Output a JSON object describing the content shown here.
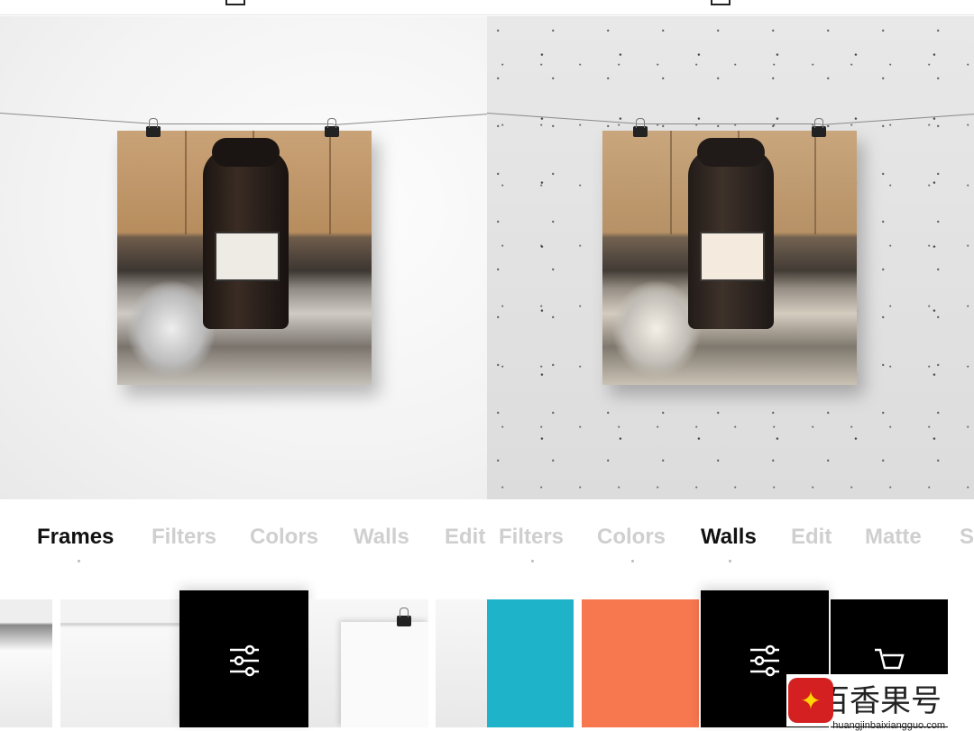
{
  "tabs_left": [
    {
      "label": "Frames",
      "active": true
    },
    {
      "label": "Filters",
      "active": false
    },
    {
      "label": "Colors",
      "active": false
    },
    {
      "label": "Walls",
      "active": false
    },
    {
      "label": "Edit",
      "active": false
    }
  ],
  "tabs_right": [
    {
      "label": "Filters",
      "active": false
    },
    {
      "label": "Colors",
      "active": false
    },
    {
      "label": "Walls",
      "active": true
    },
    {
      "label": "Edit",
      "active": false
    },
    {
      "label": "Matte",
      "active": false
    },
    {
      "label": "S",
      "active": false
    }
  ],
  "swatch_colors": {
    "cyan": "#1fb3c9",
    "orange": "#f7774f"
  },
  "icons": [
    "sliders-icon",
    "cart-icon",
    "frame-icon"
  ],
  "watermark": {
    "name": "百香果号",
    "url": "huangjinbaixiangguo.com"
  }
}
